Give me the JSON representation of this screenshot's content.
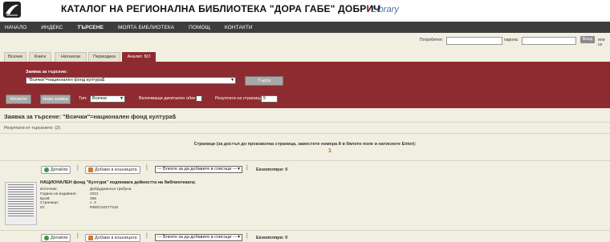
{
  "header": {
    "title": "КАТАЛОГ НА РЕГИОНАЛНА БИБЛИОТЕКА \"ДОРА ГАБЕ\" ДОБРИЧ",
    "brand_i": "i",
    "brand_rest": "Library"
  },
  "nav": [
    "НАЧАЛО",
    "ИНДЕКС",
    "ТЪРСЕНЕ",
    "МОЯТА БИБЛИОТЕКА",
    "ПОМОЩ",
    "КОНТАКТИ"
  ],
  "login": {
    "user_label": "Потребител:",
    "pass_label": "парола:",
    "login_button": "Вход",
    "extra": "или се"
  },
  "tabs": [
    "Всички",
    "Книги",
    "Нехниски",
    "Периодика",
    "Аналит. БО"
  ],
  "search": {
    "query_label": "Заявка за търсене:",
    "query_value": "\"Всички\"=национален фонд култура$",
    "search_button": "Търси",
    "type_label": "Тип:",
    "type_value": "Всички",
    "digital_label": "Включващи дигитален обект:",
    "per_page_label": "Резултати на страница:",
    "per_page_value": "5",
    "clear_button": "Изчисти",
    "new_button": "Нова заявка"
  },
  "results": {
    "query_heading": "Заявка за търсене: \"Всички\"=национален фонд култура$",
    "count_text": "Резултати от търсенето: (2)",
    "pages_info": "Страници (за достъп до произволна страница, заместете номера й в бялото поле и натиснете Enter):",
    "page": "1"
  },
  "record": {
    "details_button": "Детайли",
    "cart_button": "Добави в кошницата",
    "list_select": "--- Влезте за да добавите в списъци ---",
    "copies": "Екземпляри: 0",
    "title": "НАЦИОНАЛЕН фонд \"Култура\" подпомага дейността на библиотеката;",
    "meta": [
      {
        "label": "Източник:",
        "value": "Добруджанска трибуна"
      },
      {
        "label": "Година на издаване:",
        "value": "2021"
      },
      {
        "label": "Брой:",
        "value": "256"
      },
      {
        "label": "Страници:",
        "value": "с. 2"
      },
      {
        "label": "ID:",
        "value": "RBDG10277315"
      }
    ]
  },
  "record2": {
    "details_button": "Детайли",
    "cart_button": "Добави в кошницата",
    "list_select": "--- Влезте за да добавите в списъци ---",
    "copies": "Екземпляри: 0"
  }
}
